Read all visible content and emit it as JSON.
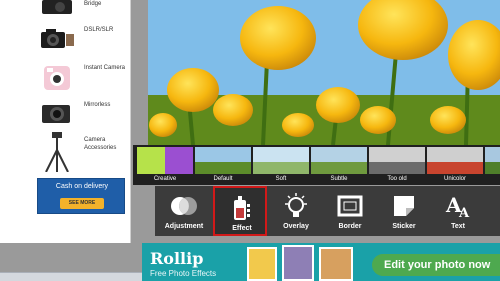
{
  "sidebar": {
    "products": [
      {
        "label": "Bridge",
        "icon": "bridge-camera-icon"
      },
      {
        "label": "DSLR/SLR",
        "icon": "dslr-camera-icon"
      },
      {
        "label": "Instant Camera",
        "icon": "instant-camera-icon"
      },
      {
        "label": "Mirrorless",
        "icon": "mirrorless-camera-icon"
      },
      {
        "label": "Camera Accessories",
        "icon": "tripod-icon"
      }
    ],
    "promo": {
      "text": "Cash on delivery",
      "button": "SEE MORE"
    }
  },
  "filters": [
    {
      "label": "Creative"
    },
    {
      "label": "Default"
    },
    {
      "label": "Soft"
    },
    {
      "label": "Subtle"
    },
    {
      "label": "Too old"
    },
    {
      "label": "Unicolor"
    }
  ],
  "tools": [
    {
      "label": "Adjustment",
      "icon": "adjustment-icon"
    },
    {
      "label": "Effect",
      "icon": "effect-icon",
      "selected": true
    },
    {
      "label": "Overlay",
      "icon": "overlay-lightbulb-icon"
    },
    {
      "label": "Border",
      "icon": "border-icon"
    },
    {
      "label": "Sticker",
      "icon": "sticker-icon"
    },
    {
      "label": "Text",
      "icon": "text-icon"
    }
  ],
  "banner": {
    "logo": "Rollip",
    "subtitle": "Free Photo Effects",
    "cta": "Edit your photo now"
  },
  "colors": {
    "selected_outline": "#d11919",
    "banner_bg": "#1aa1a8",
    "cta_bg": "#4ea94f",
    "promo_bg": "#1f5ea8"
  }
}
